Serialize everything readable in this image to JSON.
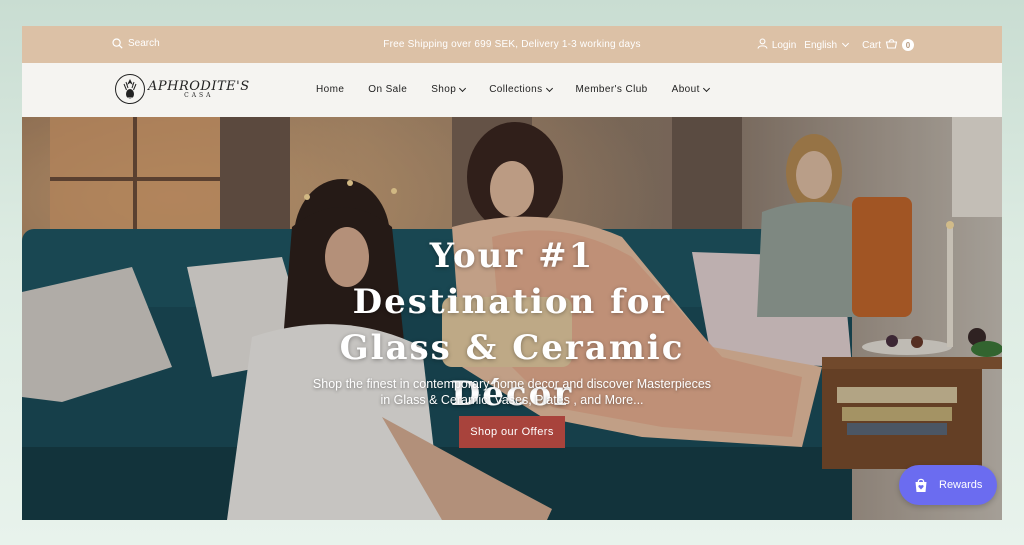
{
  "topbar": {
    "search_label": "Search",
    "announcement": "Free Shipping over 699 SEK, Delivery 1-3 working days",
    "login_label": "Login",
    "language": "English",
    "cart_label": "Cart",
    "cart_count": "0"
  },
  "header": {
    "logo_word": "APHRODITE'S",
    "logo_sub": "CASA",
    "nav": [
      {
        "label": "Home"
      },
      {
        "label": "On Sale"
      },
      {
        "label": "Shop"
      },
      {
        "label": "Collections"
      },
      {
        "label": "Member's Club"
      },
      {
        "label": "About"
      }
    ]
  },
  "hero": {
    "title": "Your #1 Destination for Glass & Ceramic Décor",
    "subtitle": "Shop the finest in contemporary home decor and discover Masterpieces in Glass & Ceramic: Vases, Plates , and More...",
    "cta_label": "Shop our Offers"
  },
  "rewards": {
    "label": "Rewards"
  },
  "colors": {
    "topbar_bg": "#dcc1a6",
    "cta_bg": "#a8433c",
    "rewards_bg": "#6b6cf0",
    "page_bg": "#dcebe2"
  },
  "icons": [
    "search-icon",
    "user-icon",
    "chevron-down-icon",
    "cart-icon",
    "logo-mark",
    "bag-heart-icon"
  ]
}
